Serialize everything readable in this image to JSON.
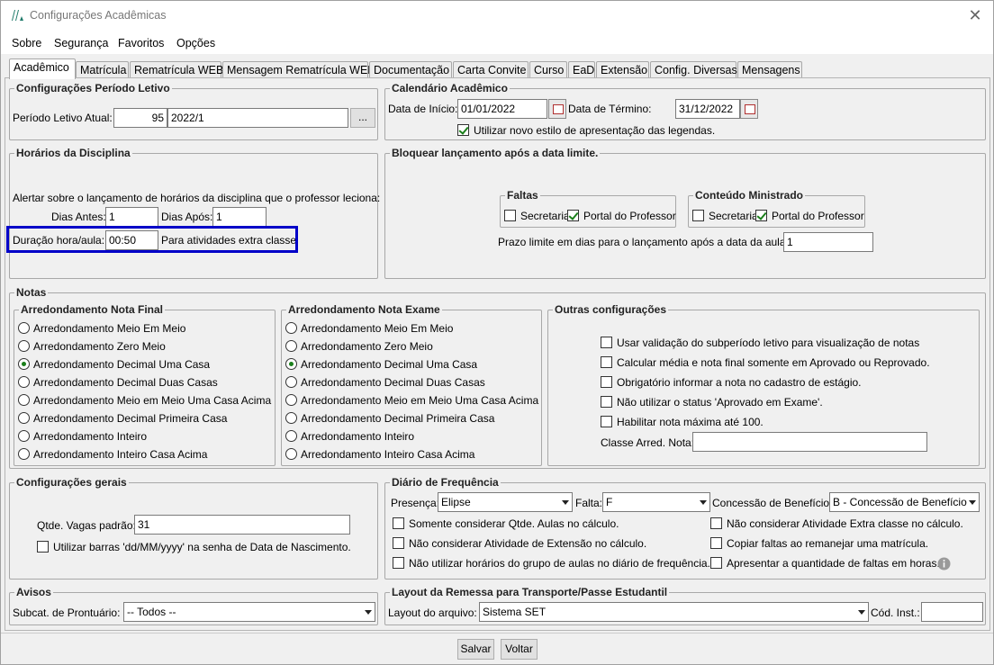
{
  "window": {
    "title": "Configurações Acadêmicas"
  },
  "menu": [
    "Sobre",
    "Segurança",
    "Favoritos",
    "Opções"
  ],
  "tabs": [
    "Acadêmico",
    "Matrícula",
    "Rematrícula WEB",
    "Mensagem Rematrícula WEB",
    "Documentação",
    "Carta Convite",
    "Curso",
    "EaD",
    "Extensão",
    "Config. Diversas",
    "Mensagens"
  ],
  "periodo": {
    "title": "Configurações Período Letivo",
    "label": "Período Letivo Atual:",
    "code": "95",
    "value": "2022/1",
    "browse": "..."
  },
  "calendario": {
    "title": "Calendário Acadêmico",
    "inicio_label": "Data de Início:",
    "inicio": "01/01/2022",
    "termino_label": "Data de Término:",
    "termino": "31/12/2022",
    "legend_check": "Utilizar novo estilo de apresentação das legendas."
  },
  "horarios": {
    "title": "Horários da Disciplina",
    "alert": "Alertar sobre o lançamento de horários da disciplina que o professor leciona:",
    "antes_label": "Dias Antes:",
    "antes": "1",
    "apos_label": "Dias Após:",
    "apos": "1",
    "duracao_label": "Duração hora/aula:",
    "duracao": "00:50",
    "extra": "Para atividades extra classe"
  },
  "bloquear": {
    "title": "Bloquear lançamento após a data limite.",
    "faltas_title": "Faltas",
    "conteudo_title": "Conteúdo Ministrado",
    "secretaria": "Secretaria",
    "portal": "Portal do Professor",
    "prazo_label": "Prazo limite em dias para o lançamento após a data da aula:",
    "prazo": "1"
  },
  "notas": {
    "title": "Notas",
    "final_title": "Arredondamento Nota Final",
    "exame_title": "Arredondamento Nota Exame",
    "options": [
      "Arredondamento Meio Em Meio",
      "Arredondamento Zero Meio",
      "Arredondamento Decimal Uma Casa",
      "Arredondamento Decimal Duas Casas",
      "Arredondamento Meio em Meio Uma Casa Acima",
      "Arredondamento Decimal Primeira Casa",
      "Arredondamento Inteiro",
      "Arredondamento Inteiro Casa Acima"
    ],
    "outras_title": "Outras configurações",
    "outras": [
      "Usar validação do subperíodo letivo para visualização de notas",
      "Calcular média e nota final somente em Aprovado ou Reprovado.",
      "Obrigatório informar a nota no cadastro de estágio.",
      "Não utilizar o status 'Aprovado em Exame'.",
      "Habilitar nota máxima até 100."
    ],
    "classe_label": "Classe Arred. Nota:"
  },
  "gerais": {
    "title": "Configurações gerais",
    "vagas_label": "Qtde. Vagas padrão:",
    "vagas": "31",
    "barras": "Utilizar barras 'dd/MM/yyyy' na senha de Data de Nascimento."
  },
  "diario": {
    "title": "Diário de Frequência",
    "presenca_label": "Presença:",
    "presenca": "Elipse",
    "falta_label": "Falta:",
    "falta": "F",
    "beneficio_label": "Concessão de Benefício:",
    "beneficio": "B - Concessão de Benefício",
    "checks_left": [
      "Somente considerar Qtde. Aulas no cálculo.",
      "Não considerar Atividade de Extensão no cálculo.",
      "Não utilizar horários do grupo de aulas no diário de frequência."
    ],
    "checks_right": [
      "Não considerar Atividade Extra classe no cálculo.",
      "Copiar faltas ao remanejar uma matrícula.",
      "Apresentar a quantidade de faltas em horas."
    ]
  },
  "avisos": {
    "title": "Avisos",
    "subcat_label": "Subcat. de Prontuário:",
    "subcat": "-- Todos --"
  },
  "layout": {
    "title": "Layout da Remessa para Transporte/Passe Estudantil",
    "arquivo_label": "Layout do arquivo:",
    "arquivo": "Sistema SET",
    "cod_label": "Cód. Inst.:"
  },
  "buttons": {
    "salvar": "Salvar",
    "voltar": "Voltar"
  },
  "colors": {
    "highlight": "#0000c8",
    "check": "#1a7f1a"
  }
}
